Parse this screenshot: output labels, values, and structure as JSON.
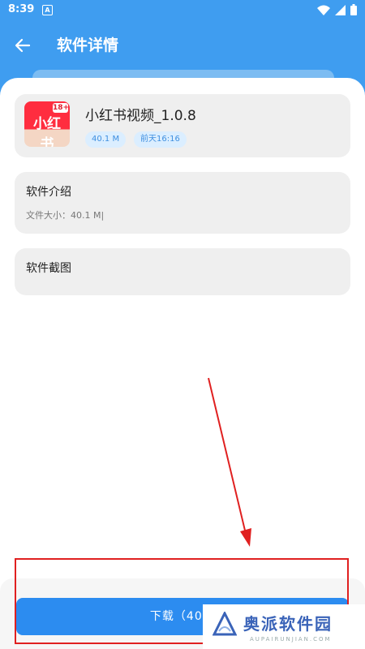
{
  "status": {
    "time": "8:39",
    "notif_glyph": "A"
  },
  "header": {
    "title": "软件详情"
  },
  "app": {
    "name": "小红书视频_1.0.8",
    "icon_text": "小红书",
    "icon_badge": "18+",
    "size_tag": "40.1 M",
    "date_tag": "前天16:16"
  },
  "intro": {
    "title": "软件介绍",
    "file_size": "文件大小：40.1 M|"
  },
  "screenshots": {
    "title": "软件截图"
  },
  "download": {
    "label": "下载（40.1"
  },
  "watermark": {
    "name": "奥派软件园",
    "domain": "AUPAIRUNJIAN.COM"
  },
  "colors": {
    "primary": "#3f9df0",
    "button": "#2c8cf0",
    "annotation": "#e02020"
  }
}
